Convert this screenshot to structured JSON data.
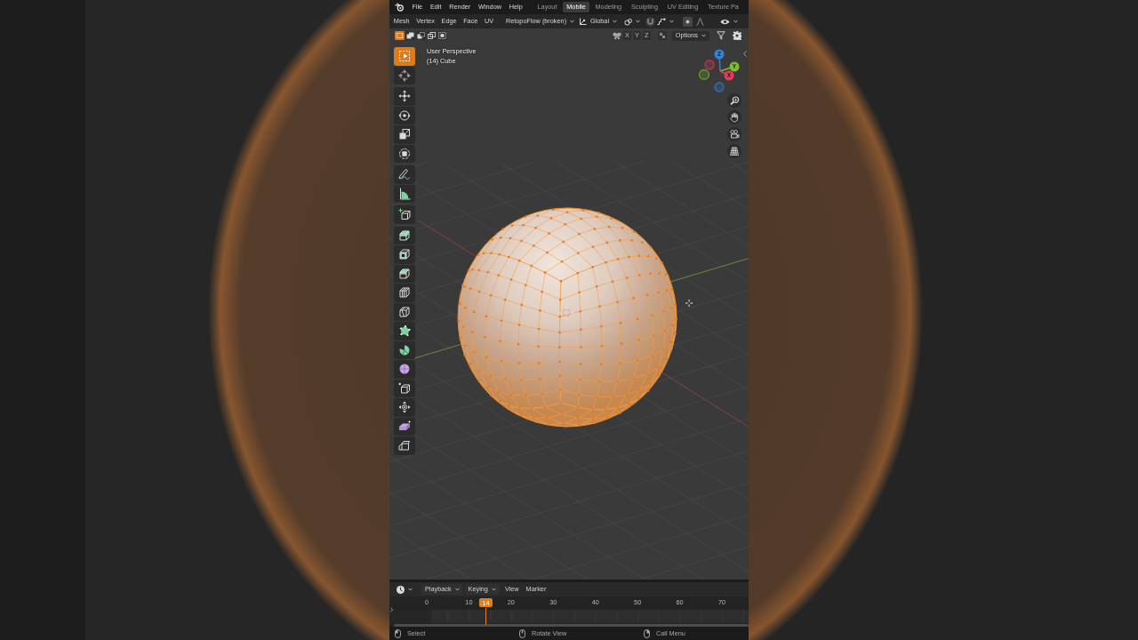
{
  "top_bar": {
    "menu": [
      "File",
      "Edit",
      "Render",
      "Window",
      "Help"
    ],
    "workspace_tabs": [
      {
        "label": "Layout",
        "selected": false
      },
      {
        "label": "Mobile",
        "selected": true
      },
      {
        "label": "Modeling",
        "selected": false
      },
      {
        "label": "Sculpting",
        "selected": false
      },
      {
        "label": "UV Editing",
        "selected": false
      },
      {
        "label": "Texture Pa",
        "selected": false
      }
    ]
  },
  "viewport_header": {
    "menu": [
      "Mesh",
      "Vertex",
      "Edge",
      "Face",
      "UV"
    ],
    "addon_dropdown": "RetopoFlow (broken)",
    "orientation_dropdown": "Global"
  },
  "tool_settings": {
    "select_modes": [
      {
        "kind": "set",
        "selected": true
      },
      {
        "kind": "extend",
        "selected": false
      },
      {
        "kind": "subtract",
        "selected": false
      },
      {
        "kind": "difference",
        "selected": false
      },
      {
        "kind": "intersect",
        "selected": false
      }
    ],
    "mirror_axes": [
      "X",
      "Y",
      "Z"
    ],
    "options_dropdown": "Options"
  },
  "viewport": {
    "view_name": "User Perspective",
    "object_info": "(14) Cube",
    "toolbar": [
      {
        "tools": [
          {
            "kind": "select-box",
            "selected": true
          },
          {
            "kind": "cursor",
            "selected": false
          }
        ]
      },
      {
        "tools": [
          {
            "kind": "move",
            "selected": false
          },
          {
            "kind": "rotate",
            "selected": false
          },
          {
            "kind": "scale",
            "selected": false
          },
          {
            "kind": "transform",
            "selected": false
          }
        ]
      },
      {
        "tools": [
          {
            "kind": "annotate",
            "selected": false
          },
          {
            "kind": "measure",
            "selected": false
          }
        ]
      },
      {
        "tools": [
          {
            "kind": "add-cube",
            "selected": false
          }
        ]
      },
      {
        "tools": [
          {
            "kind": "extrude",
            "selected": false
          },
          {
            "kind": "inset",
            "selected": false
          },
          {
            "kind": "bevel",
            "selected": false
          },
          {
            "kind": "loop-cut",
            "selected": false
          },
          {
            "kind": "knife",
            "selected": false
          },
          {
            "kind": "poly-build",
            "selected": false
          },
          {
            "kind": "spin",
            "selected": false
          },
          {
            "kind": "smooth",
            "selected": false
          },
          {
            "kind": "edge-slide",
            "selected": false
          },
          {
            "kind": "shrink-fatten",
            "selected": false
          },
          {
            "kind": "shear",
            "selected": false
          },
          {
            "kind": "rip",
            "selected": false
          }
        ]
      }
    ],
    "gizmo_axes": [
      {
        "label": "Z",
        "color": "#2f83e3"
      },
      {
        "label": "Y",
        "color": "#7cbf2a"
      },
      {
        "label": "X",
        "color": "#e9385b"
      }
    ]
  },
  "timeline": {
    "menus": [
      {
        "label": "Playback",
        "dropdown": true
      },
      {
        "label": "Keying",
        "dropdown": true
      },
      {
        "label": "View",
        "dropdown": false
      },
      {
        "label": "Marker",
        "dropdown": false
      }
    ],
    "ruler": [
      "0",
      "10",
      "20",
      "30",
      "40",
      "50",
      "60",
      "70"
    ],
    "current_frame": "14"
  },
  "status_bar": [
    {
      "kind": "left-click",
      "label": "Select"
    },
    {
      "kind": "middle-click",
      "label": "Rotate View"
    },
    {
      "kind": "right-click",
      "label": "Call Menu"
    }
  ]
}
